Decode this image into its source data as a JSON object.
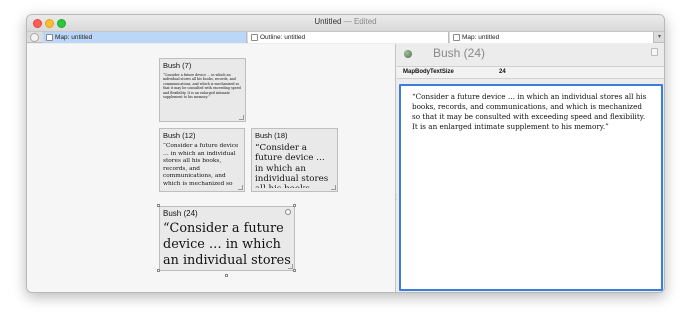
{
  "window": {
    "title": "Untitled",
    "status": "— Edited"
  },
  "tabs": [
    {
      "label": "Map: untitled",
      "active": true
    },
    {
      "label": "Outline: untitled",
      "active": false
    },
    {
      "label": "Map: untitled",
      "active": false
    }
  ],
  "map": {
    "notes": [
      {
        "title": "Bush (7)",
        "text": "“Consider a future device … in which an individual stores all his books, records, and communications, and which is mechanized so that it may be consulted with exceeding speed and flexibility. It is an enlarged intimate supplement to his memory.”"
      },
      {
        "title": "Bush (12)",
        "text": "“Consider a future device … in which an individual stores all his books, records, and communications, and which is mechanized so that it may be consulted with exceeding"
      },
      {
        "title": "Bush (18)",
        "text": "“Consider a future device … in which an individual stores all his books,"
      },
      {
        "title": "Bush (24)",
        "text": "“Consider a future device … in which an individual stores all his"
      }
    ]
  },
  "text_pane": {
    "title": "Bush (24)",
    "attribute": {
      "name": "MapBodyTextSize",
      "value": "24"
    },
    "text": "“Consider a future device … in which an individual stores all his books, records, and communications, and which is mechanized so that it may be consulted with exceeding speed and flexibility. It is an enlarged intimate supplement to his memory.”"
  },
  "colors": {
    "accent": "#3b7ddd",
    "active_tab": "#bcd6f7",
    "close": "#fe5f57",
    "minimize": "#febc2e",
    "maximize": "#28c840"
  },
  "icons": {
    "tab_bar_control": "circle-control-icon",
    "note_badge": "note-badge-icon",
    "text_pane_view": "view-toggle-icon",
    "pane_splitter": "splitter-grip-icon"
  }
}
